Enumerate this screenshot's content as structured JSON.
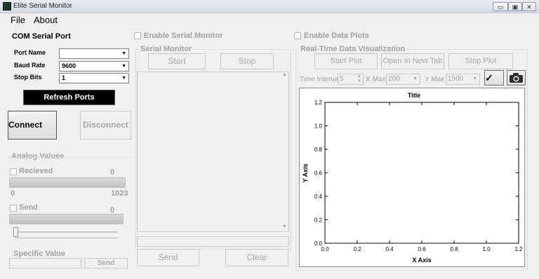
{
  "window": {
    "title": "Elite Serial Monitor",
    "controls": [
      "▭",
      "▣",
      "✕"
    ]
  },
  "menu": {
    "file": "File",
    "about": "About"
  },
  "com": {
    "heading": "COM Serial Port",
    "port_name_label": "Port Name",
    "port_name_value": "",
    "baud_rate_label": "Baud Rate",
    "baud_rate_value": "9600",
    "stop_bits_label": "Stop Bits",
    "stop_bits_value": "1",
    "refresh_label": "Refresh Ports",
    "connect_label": "Connect",
    "disconnect_label": "Disconnect"
  },
  "analog": {
    "heading": "Analog Values",
    "received_label": "Recieved",
    "received_value": "0",
    "min_label": "0",
    "max_label": "1023",
    "send_label": "Send",
    "send_value": "0",
    "slider_level": 0
  },
  "specific": {
    "heading": "Specific Value",
    "send_label": "Send"
  },
  "serial": {
    "enable_label": "Enable Serial Monitor",
    "group_heading": "Serial Monitor",
    "start_label": "Start",
    "stop_label": "Stop",
    "send_label": "Send",
    "clear_label": "Clear"
  },
  "plots": {
    "enable_label": "Enable Data Plots",
    "group_heading": "Real-Time Data Visualization",
    "start_plot_label": "Start Plot",
    "open_tab_label": "Open In New Tab",
    "stop_plot_label": "Stop Plot",
    "time_interval_label": "Time Interval",
    "time_interval_value": "5",
    "xmax_label": "X Max",
    "xmax_value": "200",
    "ymax_label": "Y Max",
    "ymax_value": "1500",
    "apply_icon": "check-icon",
    "snapshot_icon": "camera-icon"
  },
  "chart_data": {
    "type": "line",
    "title": "Title",
    "xlabel": "X Axis",
    "ylabel": "Y Axis",
    "xlim": [
      0,
      1.2
    ],
    "ylim": [
      0,
      1.2
    ],
    "x_ticks": [
      "0.0",
      "0.2",
      "0.4",
      "0.6",
      "0.8",
      "1.0",
      "1.2"
    ],
    "y_ticks": [
      "0.0",
      "0.2",
      "0.4",
      "0.6",
      "0.8",
      "1.0",
      "1.2"
    ],
    "series": []
  }
}
